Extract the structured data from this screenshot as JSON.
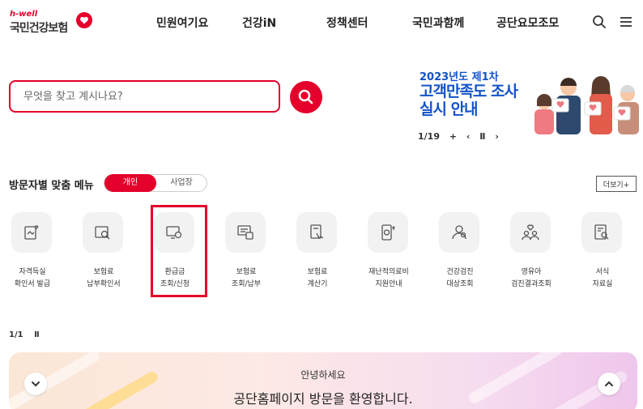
{
  "header": {
    "logo_small": "h-well",
    "logo_name": "국민건강보험",
    "nav": [
      "민원여기요",
      "건강iN",
      "정책센터",
      "국민과함께",
      "공단요모조모"
    ]
  },
  "search": {
    "placeholder": "무엇을 찾고 계시나요?"
  },
  "banner": {
    "year": "2023년도 제1차",
    "title_line1": "고객만족도 조사",
    "title_line2": "실시 안내",
    "counter": "1/19",
    "plus": "+",
    "prev": "‹",
    "pause": "Ⅱ",
    "next": "›"
  },
  "menu": {
    "title": "방문자별 맞춤 메뉴",
    "toggle_personal": "개인",
    "toggle_business": "사업장",
    "more": "더보기+",
    "items": [
      {
        "label": "자격득실\n확인서 발급"
      },
      {
        "label": "보험료\n납부확인서"
      },
      {
        "label": "환급금\n조회/신청"
      },
      {
        "label": "보험료\n조회/납부"
      },
      {
        "label": "보험료\n계산기"
      },
      {
        "label": "재난적의료비\n지원안내"
      },
      {
        "label": "건강검진\n대상조회"
      },
      {
        "label": "영유아\n검진결과조회"
      },
      {
        "label": "서식\n자료실"
      }
    ],
    "pager": "1/1",
    "pager_pause": "Ⅱ"
  },
  "welcome": {
    "hello": "안녕하세요",
    "main": "공단홈페이지 방문을 환영합니다."
  },
  "colors": {
    "brand": "#e4002b",
    "banner_blue": "#1253c9"
  }
}
